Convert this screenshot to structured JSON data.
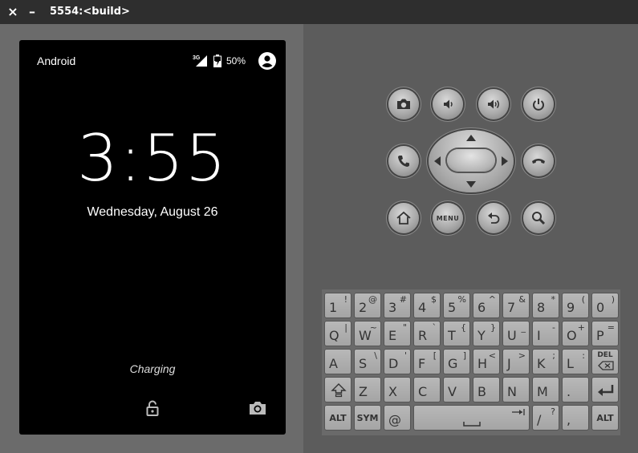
{
  "window": {
    "title": "5554:<build>",
    "close_glyph": "×",
    "minimize_glyph": "–"
  },
  "screen": {
    "carrier": "Android",
    "network": "3G",
    "battery": "50%",
    "clock": "3:55",
    "date": "Wednesday, August 26",
    "charging": "Charging"
  },
  "hardware_buttons": {
    "row1": [
      "camera-icon",
      "volume-down-icon",
      "volume-up-icon",
      "power-icon"
    ],
    "row2": [
      "call-icon",
      "dpad",
      "end-call-icon"
    ],
    "row3": [
      "home-icon",
      "menu",
      "back-icon",
      "search-icon"
    ],
    "menu_label": "MENU"
  },
  "keyboard": {
    "rows": [
      [
        {
          "m": "1",
          "a": "!"
        },
        {
          "m": "2",
          "a": "@"
        },
        {
          "m": "3",
          "a": "#"
        },
        {
          "m": "4",
          "a": "$"
        },
        {
          "m": "5",
          "a": "%"
        },
        {
          "m": "6",
          "a": "^"
        },
        {
          "m": "7",
          "a": "&"
        },
        {
          "m": "8",
          "a": "*"
        },
        {
          "m": "9",
          "a": "("
        },
        {
          "m": "0",
          "a": ")"
        }
      ],
      [
        {
          "m": "Q",
          "a": "|"
        },
        {
          "m": "W",
          "a": "~"
        },
        {
          "m": "E",
          "a": "\""
        },
        {
          "m": "R",
          "a": "`"
        },
        {
          "m": "T",
          "a": "{"
        },
        {
          "m": "Y",
          "a": "}"
        },
        {
          "m": "U",
          "a": "_"
        },
        {
          "m": "I",
          "a": "-"
        },
        {
          "m": "O",
          "a": "+"
        },
        {
          "m": "P",
          "a": "="
        }
      ],
      [
        {
          "m": "A",
          "a": ""
        },
        {
          "m": "S",
          "a": "\\"
        },
        {
          "m": "D",
          "a": "'"
        },
        {
          "m": "F",
          "a": "["
        },
        {
          "m": "G",
          "a": "]"
        },
        {
          "m": "H",
          "a": "<"
        },
        {
          "m": "J",
          "a": ">"
        },
        {
          "m": "K",
          "a": ";"
        },
        {
          "m": "L",
          "a": ":"
        }
      ],
      [
        {
          "m": "Z",
          "a": ""
        },
        {
          "m": "X",
          "a": ""
        },
        {
          "m": "C",
          "a": ""
        },
        {
          "m": "V",
          "a": ""
        },
        {
          "m": "B",
          "a": ""
        },
        {
          "m": "N",
          "a": ""
        },
        {
          "m": "M",
          "a": ""
        },
        {
          "m": ".",
          "a": ""
        }
      ],
      [
        {
          "m": "@",
          "a": ""
        },
        {
          "m": "/",
          "a": "?"
        },
        {
          "m": ",",
          "a": ""
        }
      ]
    ],
    "del_label": "DEL",
    "alt_label": "ALT",
    "sym_label": "SYM",
    "space_glyph": "␣",
    "tab_glyph": "→|"
  }
}
